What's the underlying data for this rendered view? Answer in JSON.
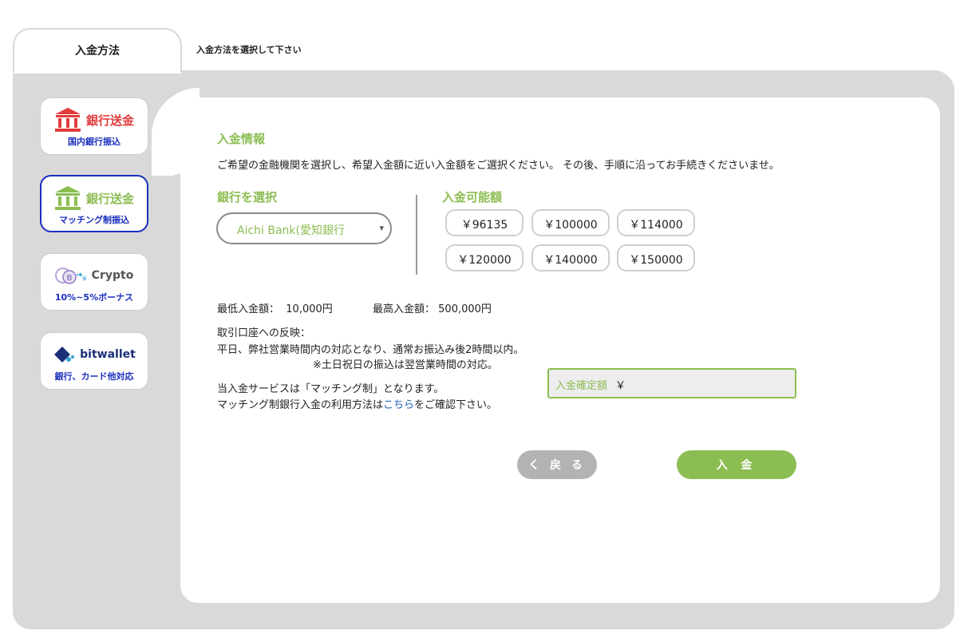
{
  "tab": {
    "label": "入金方法",
    "hint": "入金方法を選択して下さい"
  },
  "methods": [
    {
      "title": "銀行送金",
      "sub": "国内銀行振込",
      "icon": "bank-icon"
    },
    {
      "title": "銀行送金",
      "sub": "マッチング制振込",
      "icon": "bank-icon"
    },
    {
      "title": "Crypto",
      "sub": "10%~5%ボーナス",
      "icon": "crypto-icon"
    },
    {
      "title": "bitwallet",
      "sub": "銀行、カード他対応",
      "icon": "bitwallet-icon"
    }
  ],
  "main": {
    "section_title": "入金情報",
    "description": "ご希望の金融機関を選択し、希望入金額に近い入金額をご選択ください。 その後、手順に沿ってお手続きくださいませ。",
    "bank_label": "銀行を選択",
    "bank_selected": "Aichi Bank(愛知銀行",
    "amounts_label": "入金可能額",
    "amounts": [
      "￥96135",
      "￥100000",
      "￥114000",
      "￥120000",
      "￥140000",
      "￥150000"
    ],
    "min_label": "最低入金額：",
    "min_value": "10,000円",
    "max_label": "最高入金額：",
    "max_value": "500,000円",
    "reflect_title": "取引口座への反映：",
    "reflect_line1": "平日、弊社営業時間内の対応となり、通常お振込み後2時間以内。",
    "reflect_line2": "※土日祝日の振込は翌営業時間の対応。",
    "service_line": "当入金サービスは「マッチング制」となります。",
    "usage_prefix": "マッチング制銀行入金の利用方法は",
    "usage_link": "こちら",
    "usage_suffix": "をご確認下さい。",
    "confirm_label": "入金確定額",
    "confirm_value": "￥",
    "back_label": "く 戻 る",
    "deposit_label": "入 金"
  }
}
